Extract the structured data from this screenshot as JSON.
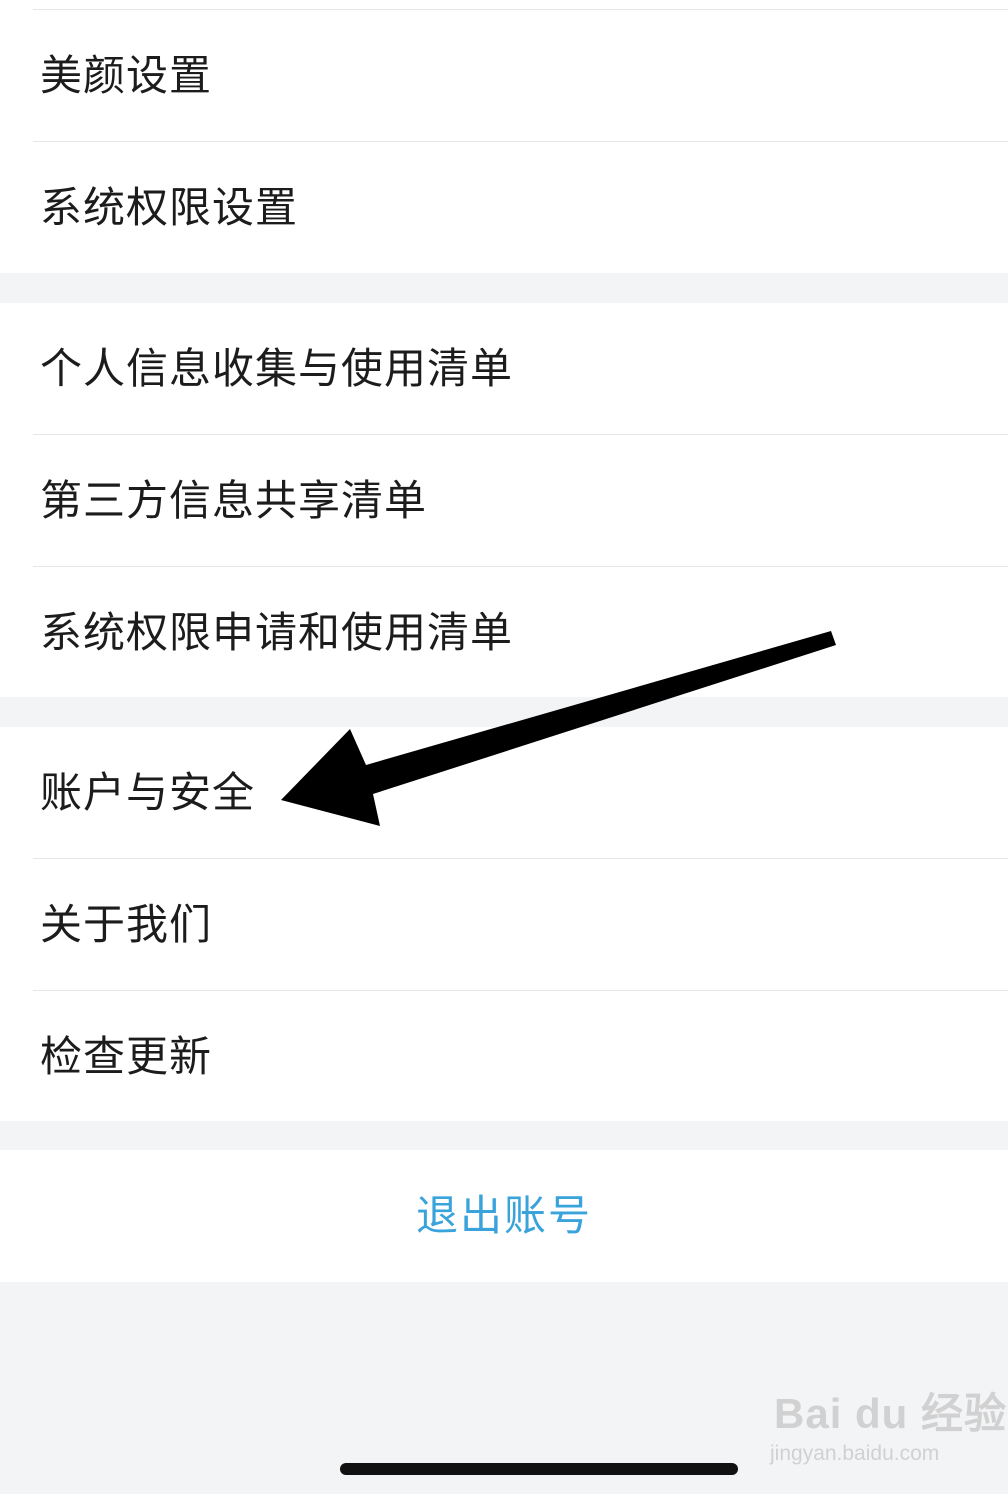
{
  "sections": [
    {
      "items": [
        {
          "label": "美颜设置"
        },
        {
          "label": "系统权限设置"
        }
      ]
    },
    {
      "items": [
        {
          "label": "个人信息收集与使用清单"
        },
        {
          "label": "第三方信息共享清单"
        },
        {
          "label": "系统权限申请和使用清单"
        }
      ]
    },
    {
      "items": [
        {
          "label": "账户与安全"
        },
        {
          "label": "关于我们"
        },
        {
          "label": "检查更新"
        }
      ]
    }
  ],
  "logout": {
    "label": "退出账号"
  },
  "colors": {
    "accent": "#3aa3dc",
    "background": "#f3f4f6",
    "text": "#1c1c1c",
    "annotation_arrow": "#000000"
  },
  "watermark": {
    "brand": "Bai du 经验",
    "site": "jingyan.baidu.com"
  }
}
